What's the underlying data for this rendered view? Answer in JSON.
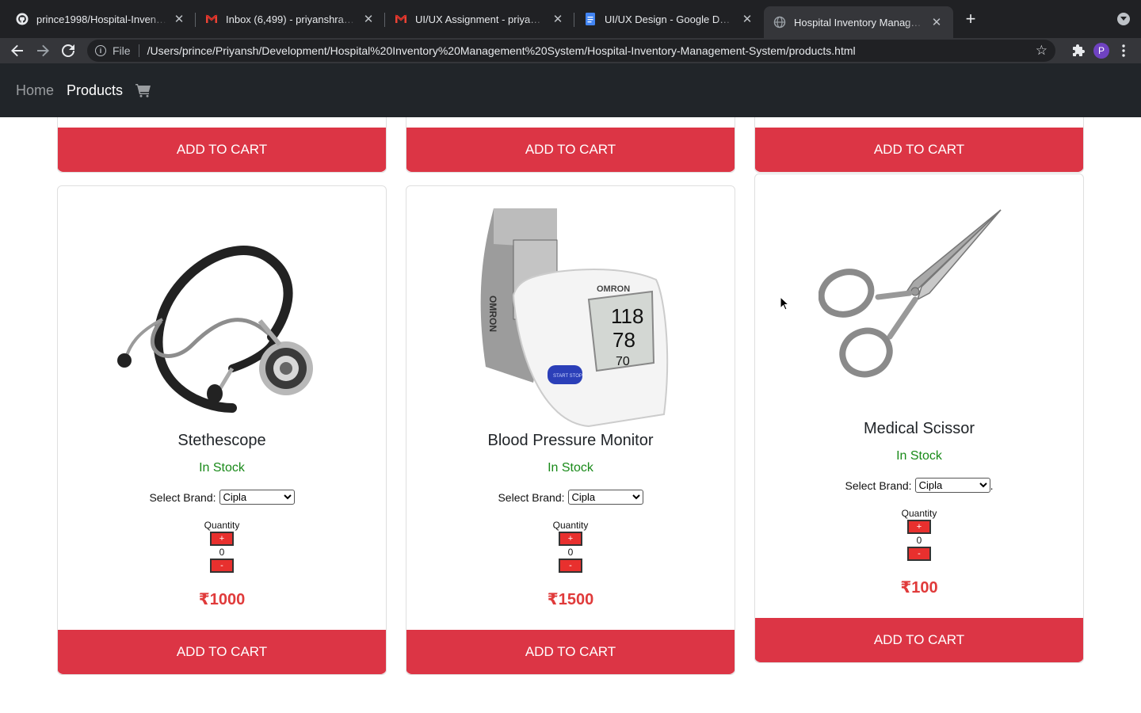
{
  "browser": {
    "tabs": [
      {
        "label": "prince1998/Hospital-Inventory",
        "icon": "github-icon"
      },
      {
        "label": "Inbox (6,499) - priyanshramna",
        "icon": "gmail-icon"
      },
      {
        "label": "UI/UX Assignment - priyansh.r",
        "icon": "gmail-icon"
      },
      {
        "label": "UI/UX Design - Google Docs",
        "icon": "docs-icon"
      },
      {
        "label": "Hospital Inventory Managemen",
        "icon": "globe-icon"
      }
    ],
    "scheme": "File",
    "url": "/Users/prince/Priyansh/Development/Hospital%20Inventory%20Management%20System/Hospital-Inventory-Management-System/products.html",
    "profile_initial": "P"
  },
  "nav": {
    "home": "Home",
    "products": "Products",
    "cart_icon": "shopping-cart-icon"
  },
  "top_row": {
    "button_label": "ADD TO CART"
  },
  "products": [
    {
      "name": "Stethescope",
      "stock": "In Stock",
      "brand_label": "Select Brand:",
      "brand": "Cipla",
      "quantity_label": "Quantity",
      "plus": "+",
      "minus": "-",
      "quantity": "0",
      "price": "₹1000",
      "button_label": "ADD TO CART"
    },
    {
      "name": "Blood Pressure Monitor",
      "stock": "In Stock",
      "brand_label": "Select Brand:",
      "brand": "Cipla",
      "quantity_label": "Quantity",
      "plus": "+",
      "minus": "-",
      "quantity": "0",
      "price": "₹1500",
      "button_label": "ADD TO CART"
    },
    {
      "name": "Medical Scissor",
      "stock": "In Stock",
      "brand_label": "Select Brand:",
      "brand": "Cipla",
      "brand_suffix": ".",
      "quantity_label": "Quantity",
      "plus": "+",
      "minus": "-",
      "quantity": "0",
      "price": "₹100",
      "button_label": "ADD TO CART"
    }
  ],
  "bp_monitor_display": {
    "brand": "OMRON",
    "sys": "118",
    "dia": "78",
    "pulse": "70",
    "button": "START STOP"
  }
}
